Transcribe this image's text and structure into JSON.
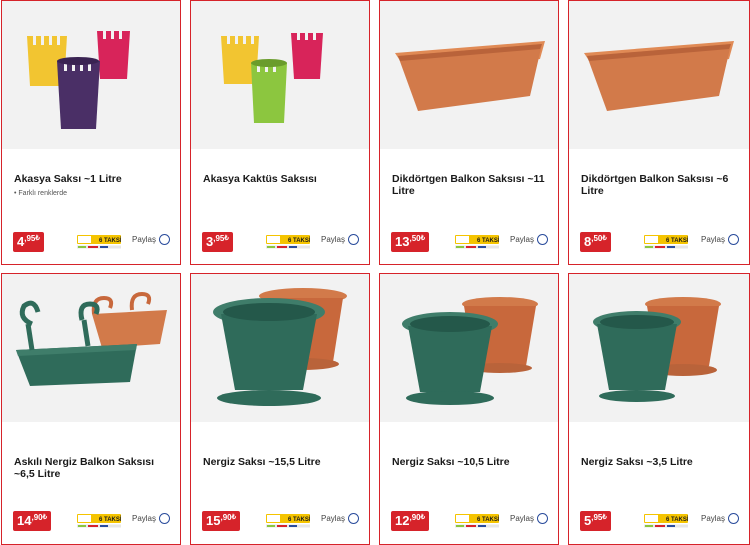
{
  "products": [
    {
      "title": "Akasya Saksı ~1 Litre",
      "note": "• Farklı renklerde",
      "price_int": "4",
      "price_dec": ",95",
      "currency": "₺",
      "share": "Paylaş",
      "image": "colorful-fence-pots"
    },
    {
      "title": "Akasya Kaktüs Saksısı",
      "note": "",
      "price_int": "3",
      "price_dec": ",95",
      "currency": "₺",
      "share": "Paylaş",
      "image": "colorful-fence-pots-small"
    },
    {
      "title": "Dikdörtgen Balkon Saksısı ~11 Litre",
      "note": "",
      "price_int": "13",
      "price_dec": ",50",
      "currency": "₺",
      "share": "Paylaş",
      "image": "terracotta-rectangular-planter"
    },
    {
      "title": "Dikdörtgen Balkon Saksısı ~6 Litre",
      "note": "",
      "price_int": "8",
      "price_dec": ",50",
      "currency": "₺",
      "share": "Paylaş",
      "image": "terracotta-rectangular-planter"
    },
    {
      "title": "Askılı Nergiz Balkon Saksısı ~6,5 Litre",
      "note": "",
      "price_int": "14",
      "price_dec": ",90",
      "currency": "₺",
      "share": "Paylaş",
      "image": "hanging-balcony-planters"
    },
    {
      "title": "Nergiz Saksı ~15,5 Litre",
      "note": "",
      "price_int": "15",
      "price_dec": ",90",
      "currency": "₺",
      "share": "Paylaş",
      "image": "round-pots-green-terracotta"
    },
    {
      "title": "Nergiz Saksı ~10,5 Litre",
      "note": "",
      "price_int": "12",
      "price_dec": ",90",
      "currency": "₺",
      "share": "Paylaş",
      "image": "round-pots-green-terracotta"
    },
    {
      "title": "Nergiz Saksı ~3,5 Litre",
      "note": "",
      "price_int": "5",
      "price_dec": ",95",
      "currency": "₺",
      "share": "Paylaş",
      "image": "round-pots-green-terracotta"
    }
  ],
  "badge": {
    "top": "PEŞİN FİYATINA",
    "main": "6 TAKSİT",
    "cards": "Bonus World Axess Maximum Paraf Card Finans"
  },
  "colors": {
    "accent": "#d6232a",
    "share_circle": "#2a4c9c",
    "green_pot": "#2f6b5a",
    "terracotta": "#d27a4a",
    "yellow": "#f2c531",
    "pink": "#d8245a",
    "purple": "#4a2f66",
    "lime": "#8cc63f",
    "badge_yellow": "#f5c400"
  }
}
